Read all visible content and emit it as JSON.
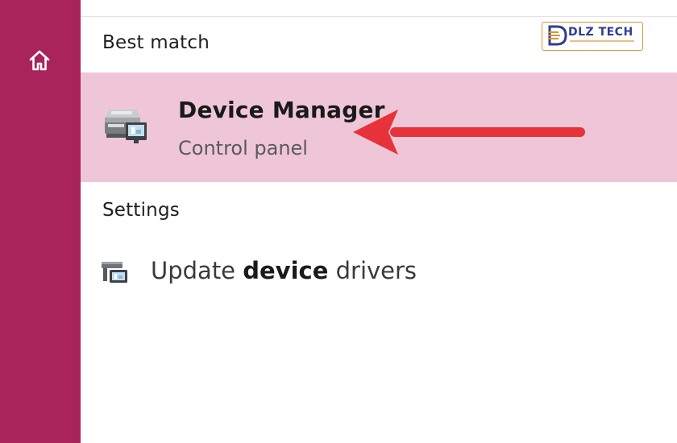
{
  "sidebar": {
    "home_icon": "home-icon",
    "color": "#a8245a"
  },
  "best_match": {
    "header": "Best match",
    "item": {
      "title": "Device Manager",
      "subtitle": "Control panel",
      "icon": "device-manager-icon",
      "highlight_color": "#efc6d8"
    },
    "annotation_arrow_color": "#e8323a"
  },
  "settings": {
    "header": "Settings",
    "item": {
      "label_prefix": "Update ",
      "label_bold": "device",
      "label_suffix": " drivers",
      "icon": "update-drivers-icon"
    }
  },
  "watermark": {
    "text": "DLZ TECH",
    "mark_letter": "D",
    "brand_color": "#2f3e90",
    "accent_color": "#d9943c"
  }
}
